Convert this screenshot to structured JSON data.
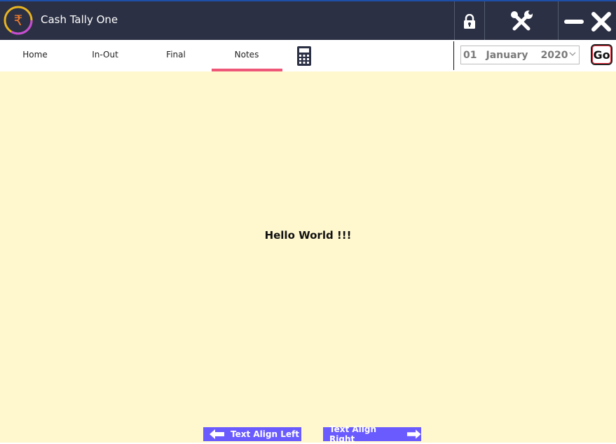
{
  "app": {
    "title": "Cash Tally One"
  },
  "nav": {
    "tabs": [
      {
        "label": "Home"
      },
      {
        "label": "In-Out"
      },
      {
        "label": "Final"
      },
      {
        "label": "Notes",
        "active": true
      }
    ]
  },
  "date": {
    "day": "01",
    "month": "January",
    "year": "2020"
  },
  "go_label": "Go",
  "note": {
    "text": "Hello World !!!"
  },
  "buttons": {
    "align_left": "Text Align Left",
    "align_right": "Text Align Right"
  },
  "colors": {
    "titlebar": "#2b3044",
    "content_bg": "#fff8cf",
    "active_tab": "#ef5778",
    "button": "#6a5bff"
  }
}
